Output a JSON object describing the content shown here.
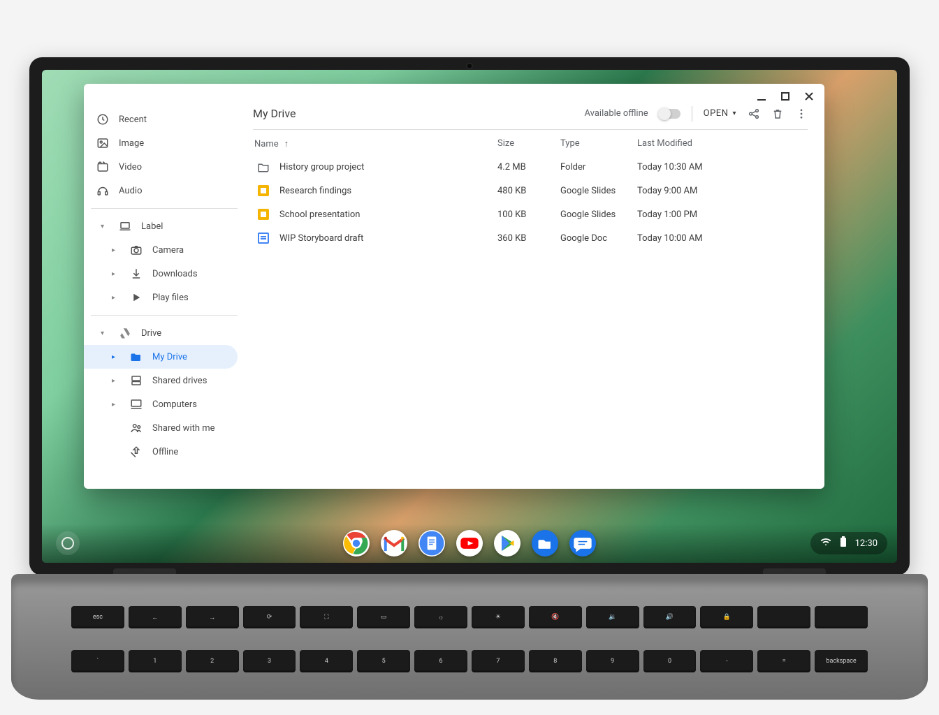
{
  "sidebar": {
    "quick": [
      {
        "label": "Recent",
        "icon": "clock-icon"
      },
      {
        "label": "Image",
        "icon": "image-icon"
      },
      {
        "label": "Video",
        "icon": "video-icon"
      },
      {
        "label": "Audio",
        "icon": "audio-icon"
      }
    ],
    "label_section": {
      "header": "Label",
      "items": [
        {
          "label": "Camera",
          "icon": "camera-icon"
        },
        {
          "label": "Downloads",
          "icon": "download-icon"
        },
        {
          "label": "Play files",
          "icon": "play-icon"
        }
      ]
    },
    "drive_section": {
      "header": "Drive",
      "items": [
        {
          "label": "My Drive",
          "icon": "drive-folder-icon",
          "active": true
        },
        {
          "label": "Shared drives",
          "icon": "shared-drives-icon"
        },
        {
          "label": "Computers",
          "icon": "computer-icon"
        },
        {
          "label": "Shared with me",
          "icon": "shared-with-me-icon"
        },
        {
          "label": "Offline",
          "icon": "offline-pin-icon"
        }
      ]
    }
  },
  "main": {
    "title": "My Drive",
    "offline_label": "Available offline",
    "open_label": "OPEN",
    "columns": {
      "name": "Name",
      "size": "Size",
      "type": "Type",
      "modified": "Last Modified"
    },
    "rows": [
      {
        "name": "History group project",
        "size": "4.2 MB",
        "type": "Folder",
        "modified": "Today 10:30 AM",
        "icon": "folder"
      },
      {
        "name": "Research findings",
        "size": "480 KB",
        "type": "Google Slides",
        "modified": "Today 9:00 AM",
        "icon": "slides"
      },
      {
        "name": "School presentation",
        "size": "100 KB",
        "type": "Google Slides",
        "modified": "Today 1:00 PM",
        "icon": "slides"
      },
      {
        "name": "WIP Storyboard draft",
        "size": "360 KB",
        "type": "Google Doc",
        "modified": "Today 10:00 AM",
        "icon": "doc"
      }
    ]
  },
  "shelf": {
    "apps": [
      "chrome",
      "gmail",
      "docs",
      "youtube",
      "play",
      "files",
      "messages"
    ],
    "time": "12:30"
  }
}
